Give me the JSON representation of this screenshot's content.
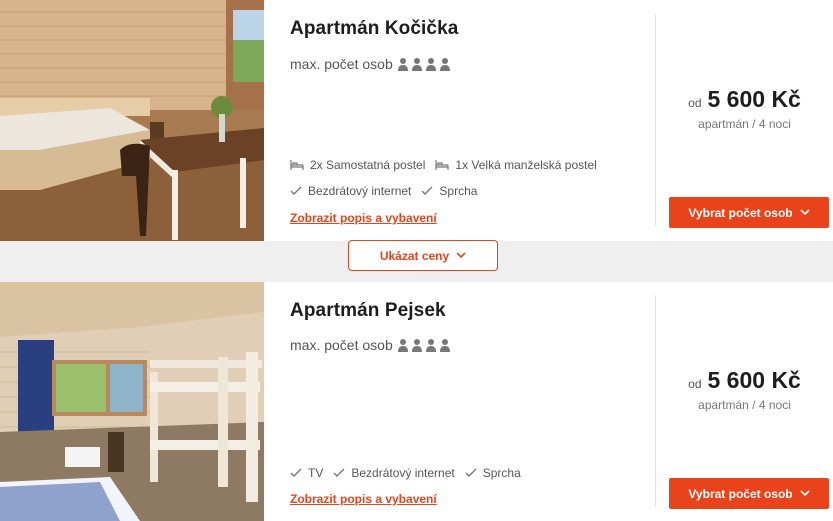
{
  "colors": {
    "accent": "#e8431a",
    "text": "#1d1d1d",
    "muted": "#555555"
  },
  "show_prices_label": "Ukázat ceny",
  "apartments": [
    {
      "title": "Apartmán Kočička",
      "max_persons_label": "max. počet osob",
      "max_persons": 4,
      "beds": [
        "2x Samostatná postel",
        "1x Velká manželská postel"
      ],
      "amenities": [
        "Bezdrátový internet",
        "Sprcha"
      ],
      "details_link": "Zobrazit popis a vybavení",
      "price_prefix": "od",
      "price": "5 600 Kč",
      "price_note": "apartmán / 4 noci",
      "select_button": "Vybrat počet osob"
    },
    {
      "title": "Apartmán Pejsek",
      "max_persons_label": "max. počet osob",
      "max_persons": 4,
      "beds": [],
      "amenities": [
        "TV",
        "Bezdrátový internet",
        "Sprcha"
      ],
      "details_link": "Zobrazit popis a vybavení",
      "price_prefix": "od",
      "price": "5 600 Kč",
      "price_note": "apartmán / 4 noci",
      "select_button": "Vybrat počet osob"
    }
  ]
}
